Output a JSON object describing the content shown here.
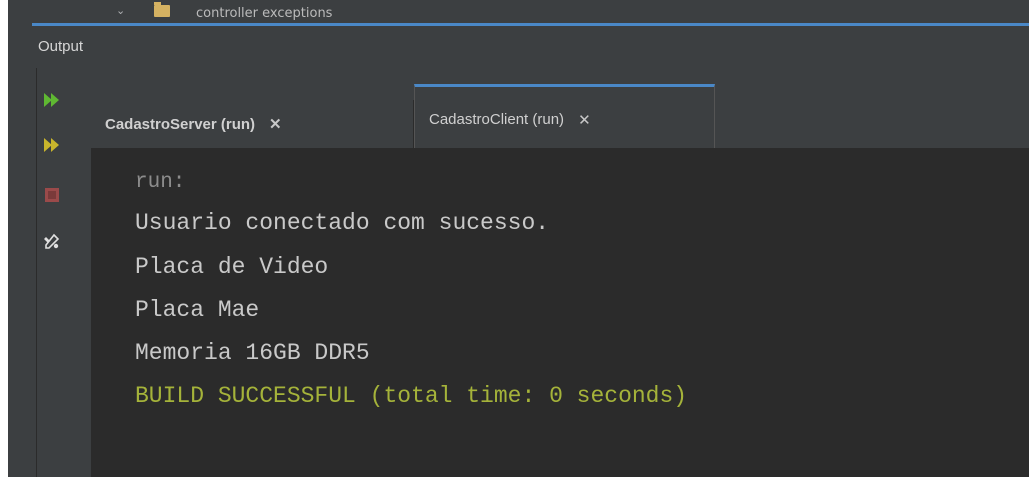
{
  "tree": {
    "partial_label": "controller exceptions"
  },
  "panel": {
    "title": "Output"
  },
  "toolbar": {
    "buttons": [
      {
        "name": "rerun-icon"
      },
      {
        "name": "rerun-with-params-icon"
      },
      {
        "name": "stop-icon"
      },
      {
        "name": "settings-icon"
      }
    ]
  },
  "tabs": [
    {
      "label": "CadastroServer (run)",
      "close": "✕",
      "active": false
    },
    {
      "label": "CadastroClient (run)",
      "close": "✕",
      "active": true
    }
  ],
  "console": {
    "lines": [
      {
        "text": "run:",
        "kind": "meta"
      },
      {
        "text": "Usuario conectado com sucesso.",
        "kind": "normal"
      },
      {
        "text": "Placa de Video",
        "kind": "normal"
      },
      {
        "text": "Placa Mae",
        "kind": "normal"
      },
      {
        "text": "Memoria 16GB DDR5",
        "kind": "normal"
      },
      {
        "text": "BUILD SUCCESSFUL (total time: 0 seconds)",
        "kind": "success"
      }
    ]
  },
  "colors": {
    "accent": "#4a88c7",
    "panel_bg": "#3c3f41",
    "console_bg": "#2b2b2b",
    "success_text": "#a5b33a",
    "run_green": "#5fb832",
    "stop_red": "#9a4a4a"
  }
}
